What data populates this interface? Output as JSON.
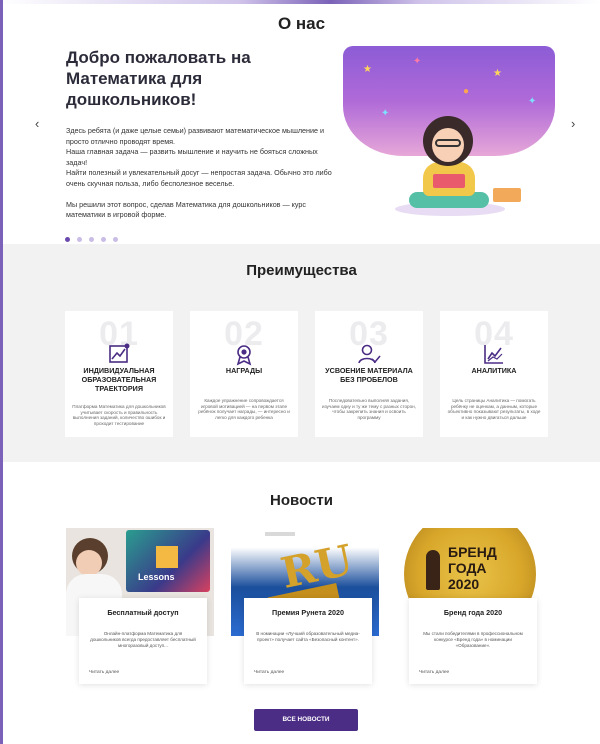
{
  "about": {
    "title": "О нас",
    "heading_line1": "Добро пожаловать на",
    "heading_line2": "Математика для дошкольников!",
    "text": [
      "Здесь ребята (и даже целые семьи) развивают математическое мышление и просто отлично проводят время.",
      "Наша главная задача — развить мышление и научить не бояться сложных задач!",
      "Найти полезный и увлекательный досуг — непростая задача. Обычно это либо очень скучная польза, либо бесполезное веселье.",
      "Мы решили этот вопрос, сделав Математика для дошкольников — курс математики в игровой форме."
    ],
    "slide_count": 5,
    "active_slide": 1,
    "prev_arrow": "‹",
    "next_arrow": "›"
  },
  "advantages": {
    "title": "Преимущества",
    "items": [
      {
        "num": "01",
        "title": "ИНДИВИДУАЛЬНАЯ ОБРАЗОВАТЕЛЬНАЯ ТРАЕКТОРИЯ",
        "icon": "chart-growth-icon",
        "text": "Платформа Математика для дошкольников учитывает скорость и правильность выполнения заданий, количество ошибок и проходит тестирование"
      },
      {
        "num": "02",
        "title": "НАГРАДЫ",
        "icon": "award-medal-icon",
        "text": "Каждое упражнение сопровождается игровой мотивацией — на первом этапе ребёнок получает награды, — интересно и легко для каждого ребенка"
      },
      {
        "num": "03",
        "title": "УСВОЕНИЕ МАТЕРИАЛА БЕЗ ПРОБЕЛОВ",
        "icon": "person-check-icon",
        "text": "Последовательно выполняя задания, изучаем одну и ту же тему с разных сторон, чтобы закрепить знания и освоить программу"
      },
      {
        "num": "04",
        "title": "АНАЛИТИКА",
        "icon": "analytics-icon",
        "text": "Цель страницы Аналитика — помогать ребёнку не оценкам, а данным, которые объективно показывают результаты, в ходе и как нужно двигаться дальше"
      }
    ]
  },
  "news": {
    "title": "Новости",
    "items": [
      {
        "title": "Бесплатный доступ",
        "text": "Онлайн-платформа Математика для дошкольников всегда предоставляет бесплатный многоразовый доступ...",
        "more": "Читать далее"
      },
      {
        "title": "Премия Рунета 2020",
        "text": "В номинации «Лучший образовательный медиа-проект» получает сайта «Безопасный контент».",
        "more": "Читать далее"
      },
      {
        "title": "Бренд года 2020",
        "text": "Мы стали победителями в профессиональном конкурсе «Бренд года» в номинации «Образование».",
        "more": "Читать далее"
      }
    ],
    "button": "ВСЕ НОВОСТИ",
    "image_text_lessons": "Lessons",
    "image_text_ru": "RU",
    "image_text_brand": "БРЕНД ГОДА 2020"
  },
  "colors": {
    "accent": "#4b2d85",
    "dot_active": "#6a4aae",
    "dot_inactive": "#c9bde6",
    "section_gray": "#f2f2f2"
  }
}
